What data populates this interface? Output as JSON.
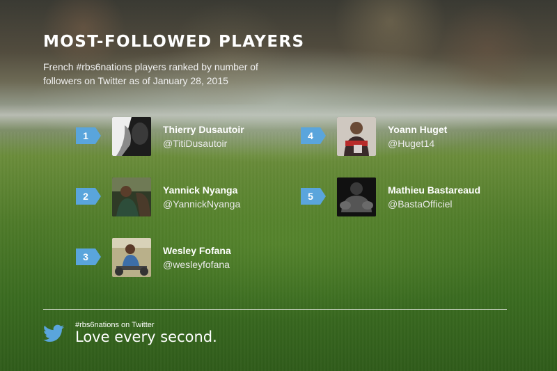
{
  "header": {
    "title": "MOST-FOLLOWED PLAYERS",
    "subtitle": "French #rbs6nations players ranked by number of followers on Twitter as of January 28, 2015"
  },
  "players": [
    {
      "rank": "1",
      "name": "Thierry Dusautoir",
      "handle": "@TitiDusautoir"
    },
    {
      "rank": "2",
      "name": "Yannick Nyanga",
      "handle": "@YannickNyanga"
    },
    {
      "rank": "3",
      "name": "Wesley Fofana",
      "handle": "@wesleyfofana"
    },
    {
      "rank": "4",
      "name": "Yoann Huget",
      "handle": "@Huget14"
    },
    {
      "rank": "5",
      "name": "Mathieu Bastareaud",
      "handle": "@BastaOfficiel"
    }
  ],
  "footer": {
    "icon": "twitter-bird-icon",
    "hashtag_line": "#rbs6nations on Twitter",
    "slogan": "Love every second."
  },
  "colors": {
    "rank_badge": "#5aa5dc",
    "twitter_icon": "#5aa5dc",
    "text": "#ffffff"
  }
}
